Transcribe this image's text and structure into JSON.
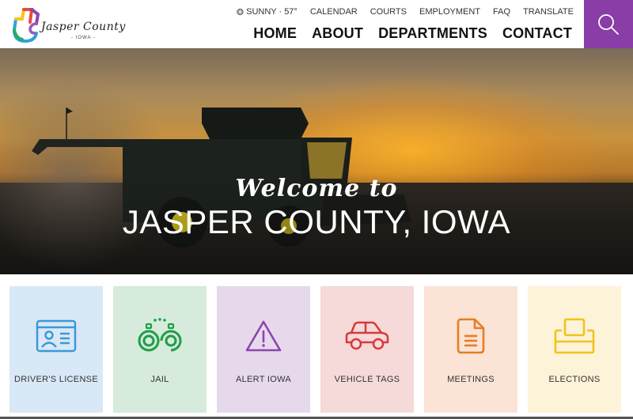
{
  "header": {
    "logo": {
      "title": "Jasper County",
      "subtitle": "- IOWA -"
    },
    "utility_nav": {
      "weather": {
        "icon": "sun-icon",
        "text": "SUNNY · 57°"
      },
      "items": [
        {
          "label": "CALENDAR"
        },
        {
          "label": "COURTS"
        },
        {
          "label": "EMPLOYMENT"
        },
        {
          "label": "FAQ"
        },
        {
          "label": "TRANSLATE"
        }
      ]
    },
    "main_nav": {
      "items": [
        {
          "label": "HOME"
        },
        {
          "label": "ABOUT"
        },
        {
          "label": "DEPARTMENTS"
        },
        {
          "label": "CONTACT"
        }
      ]
    },
    "search": {
      "icon": "search-icon",
      "color": "#8a3da6"
    }
  },
  "hero": {
    "welcome": "Welcome to",
    "title": "JASPER COUNTY, IOWA"
  },
  "cards": [
    {
      "label": "DRIVER'S LICENSE",
      "icon": "id-card-icon",
      "bg": "#d9e8f7",
      "color": "#3a9ad9"
    },
    {
      "label": "JAIL",
      "icon": "handcuffs-icon",
      "bg": "#d6ebdb",
      "color": "#1e9e4a"
    },
    {
      "label": "ALERT IOWA",
      "icon": "warning-icon",
      "bg": "#e6d9ec",
      "color": "#8e44ad"
    },
    {
      "label": "VEHICLE TAGS",
      "icon": "car-icon",
      "bg": "#f6d9d9",
      "color": "#d63a3a"
    },
    {
      "label": "MEETINGS",
      "icon": "document-icon",
      "bg": "#fbe3d6",
      "color": "#e67e22"
    },
    {
      "label": "ELECTIONS",
      "icon": "ballot-box-icon",
      "bg": "#fdf3d8",
      "color": "#f2c21a"
    }
  ]
}
